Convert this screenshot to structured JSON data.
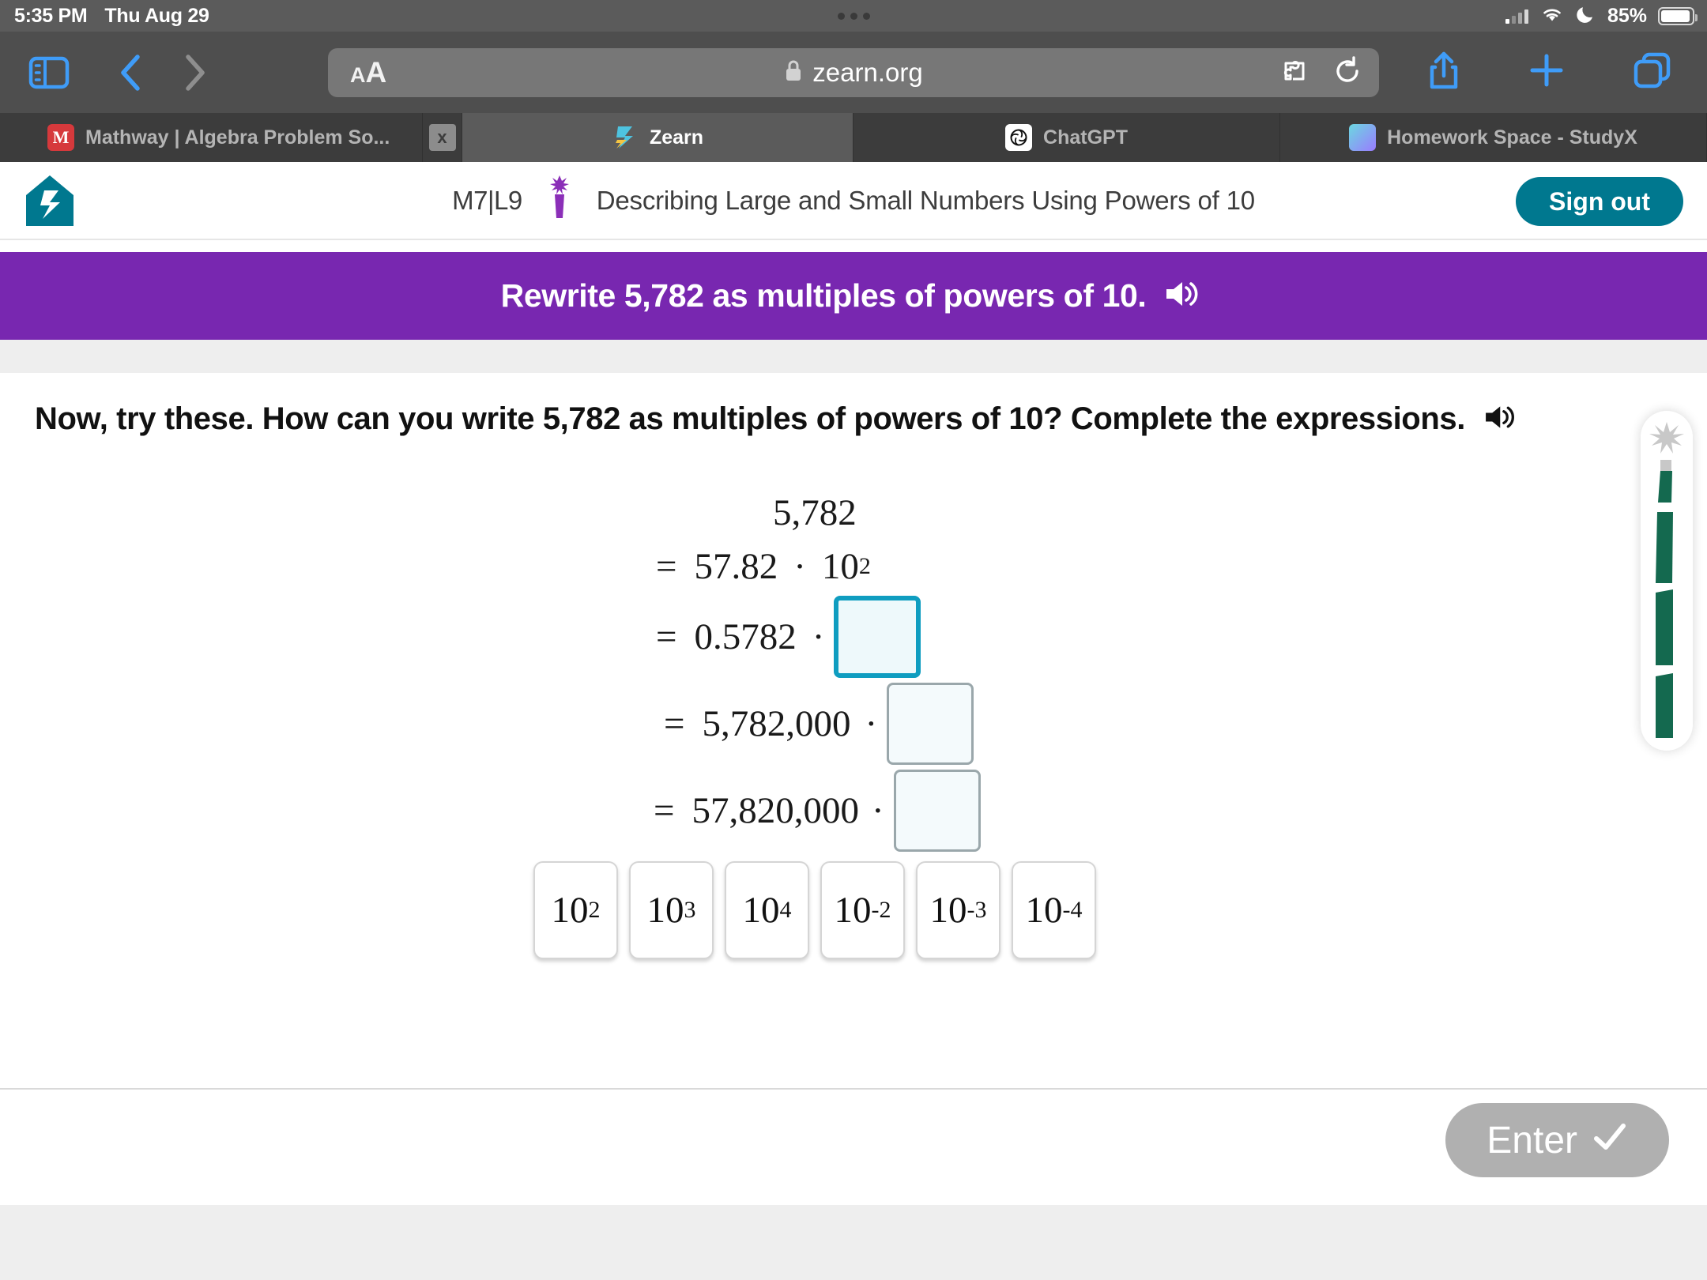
{
  "status_bar": {
    "time": "5:35 PM",
    "date": "Thu Aug 29",
    "battery_percent": "85%",
    "icons": [
      "cellular-signal-icon",
      "wifi-icon",
      "do-not-disturb-icon",
      "battery-icon"
    ]
  },
  "browser": {
    "url": "zearn.org",
    "text_size_small": "A",
    "text_size_large": "A",
    "icons": {
      "sidebar": "sidebar-icon",
      "back": "back-arrow-icon",
      "forward": "forward-arrow-icon",
      "lock": "lock-icon",
      "extension": "puzzle-extension-icon",
      "reload": "reload-icon",
      "share": "share-icon",
      "new_tab": "plus-icon",
      "tabs_overview": "tabs-overview-icon"
    },
    "tabs": [
      {
        "title": "Mathway | Algebra Problem So...",
        "favicon": "mathway-favicon",
        "active": false
      },
      {
        "title": "Zearn",
        "favicon": "zearn-favicon",
        "active": true
      },
      {
        "title": "ChatGPT",
        "favicon": "chatgpt-favicon",
        "active": false
      },
      {
        "title": "Homework Space - StudyX",
        "favicon": "studyx-favicon",
        "active": false
      }
    ],
    "close_label": "x"
  },
  "app_header": {
    "logo": "zearn-house-logo",
    "lesson_code": "M7|L9",
    "sparkler_icon": "sparkler-icon",
    "lesson_title": "Describing Large and Small Numbers Using Powers of 10",
    "sign_out_label": "Sign out",
    "accent_color": "#00788f"
  },
  "banner": {
    "text": "Rewrite 5,782 as multiples of powers of 10.",
    "audio_icon": "speaker-icon",
    "background_color": "#7827b0"
  },
  "main": {
    "prompt": "Now, try these. How can you write 5,782 as multiples of powers of 10? Complete the expressions.",
    "prompt_audio_icon": "speaker-icon",
    "equations": {
      "original": "5,782",
      "rows": [
        {
          "equals": "=",
          "coefficient": "57.82",
          "dot": "·",
          "power_base": "10",
          "power_exp": "2",
          "has_input": false
        },
        {
          "equals": "=",
          "coefficient": "0.5782",
          "dot": "·",
          "has_input": true,
          "input_value": "",
          "input_state": "active"
        },
        {
          "equals": "=",
          "coefficient": "5,782,000",
          "dot": "·",
          "has_input": true,
          "input_value": "",
          "input_state": "idle"
        },
        {
          "equals": "=",
          "coefficient": "57,820,000",
          "dot": "·",
          "has_input": true,
          "input_value": "",
          "input_state": "idle"
        }
      ]
    },
    "answer_tiles": [
      {
        "base": "10",
        "exponent": "2"
      },
      {
        "base": "10",
        "exponent": "3"
      },
      {
        "base": "10",
        "exponent": "4"
      },
      {
        "base": "10",
        "exponent": "-2"
      },
      {
        "base": "10",
        "exponent": "-3"
      },
      {
        "base": "10",
        "exponent": "-4"
      }
    ],
    "progress_indicator": "rocket-progress-icon"
  },
  "footer": {
    "enter_label": "Enter",
    "enter_check_icon": "check-icon",
    "enter_enabled": false
  }
}
